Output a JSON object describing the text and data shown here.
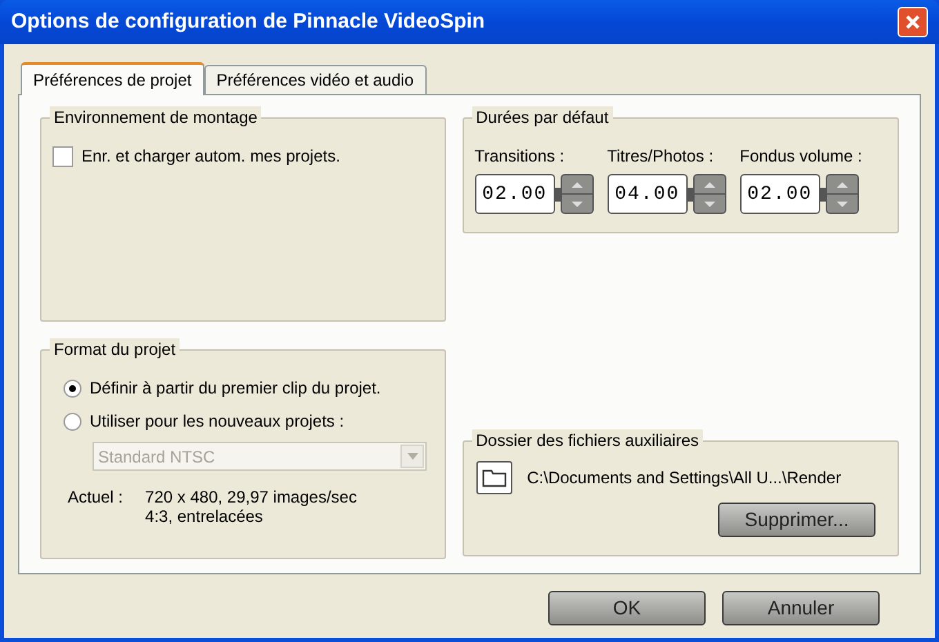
{
  "window": {
    "title": "Options de configuration de Pinnacle VideoSpin"
  },
  "tabs": [
    {
      "label": "Préférences de projet",
      "selected": true
    },
    {
      "label": "Préférences vidéo et audio",
      "selected": false
    }
  ],
  "editing_environment": {
    "title": "Environnement de montage",
    "autosave": {
      "label": "Enr. et charger autom. mes projets.",
      "checked": false
    }
  },
  "project_format": {
    "title": "Format du projet",
    "options": [
      {
        "label": "Définir à partir du premier clip du projet.",
        "selected": true
      },
      {
        "label": "Utiliser pour les nouveaux projets :",
        "selected": false
      }
    ],
    "preset": {
      "value": "Standard NTSC",
      "disabled": true
    },
    "current_label": "Actuel :",
    "current_lines": [
      "720 x 480, 29,97 images/sec",
      "4:3, entrelacées"
    ]
  },
  "default_durations": {
    "title": "Durées par défaut",
    "fields": [
      {
        "label": "Transitions :",
        "value": "02.00"
      },
      {
        "label": "Titres/Photos :",
        "value": "04.00"
      },
      {
        "label": "Fondus volume :",
        "value": "02.00"
      }
    ]
  },
  "aux_folder": {
    "title": "Dossier des fichiers auxiliaires",
    "path": "C:\\Documents and Settings\\All U...\\Render",
    "button": "Supprimer..."
  },
  "buttons": [
    "OK",
    "Annuler"
  ]
}
